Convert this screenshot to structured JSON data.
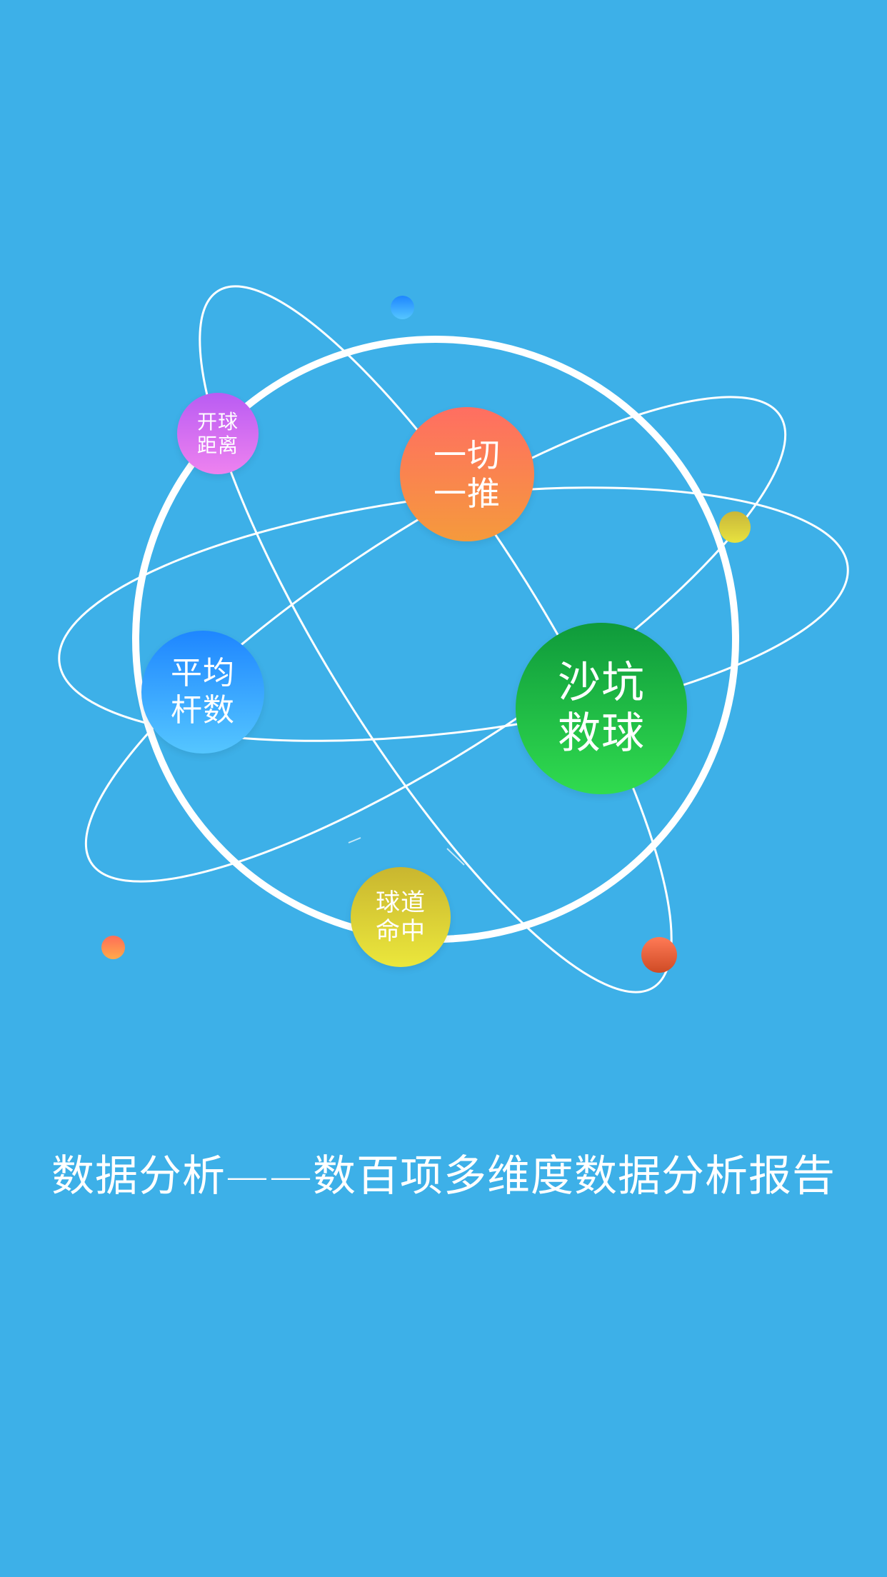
{
  "bubbles": {
    "drive_distance": {
      "label": "开球\n距离",
      "color_from": "#b95cf3",
      "color_to": "#ee82ef"
    },
    "putting": {
      "label": "一切\n一推",
      "color_from": "#ff6e62",
      "color_to": "#f59a3c"
    },
    "average_strokes": {
      "label": "平均\n杆数",
      "color_from": "#1e86ff",
      "color_to": "#55c6ff"
    },
    "bunker_save": {
      "label": "沙坑\n救球",
      "color_from": "#0f9a3b",
      "color_to": "#30db4f"
    },
    "fairway_hit": {
      "label": "球道\n命中",
      "color_from": "#c9b62f",
      "color_to": "#ebe73c"
    }
  },
  "decor_dots": {
    "top_blue": "#2a8cff",
    "right_yellow": "#d8d93a",
    "left_orange": "#ff8d5c",
    "bottom_red": "#e65a35"
  },
  "headline": {
    "text": "数据分析——数百项多维度数据分析报告"
  }
}
